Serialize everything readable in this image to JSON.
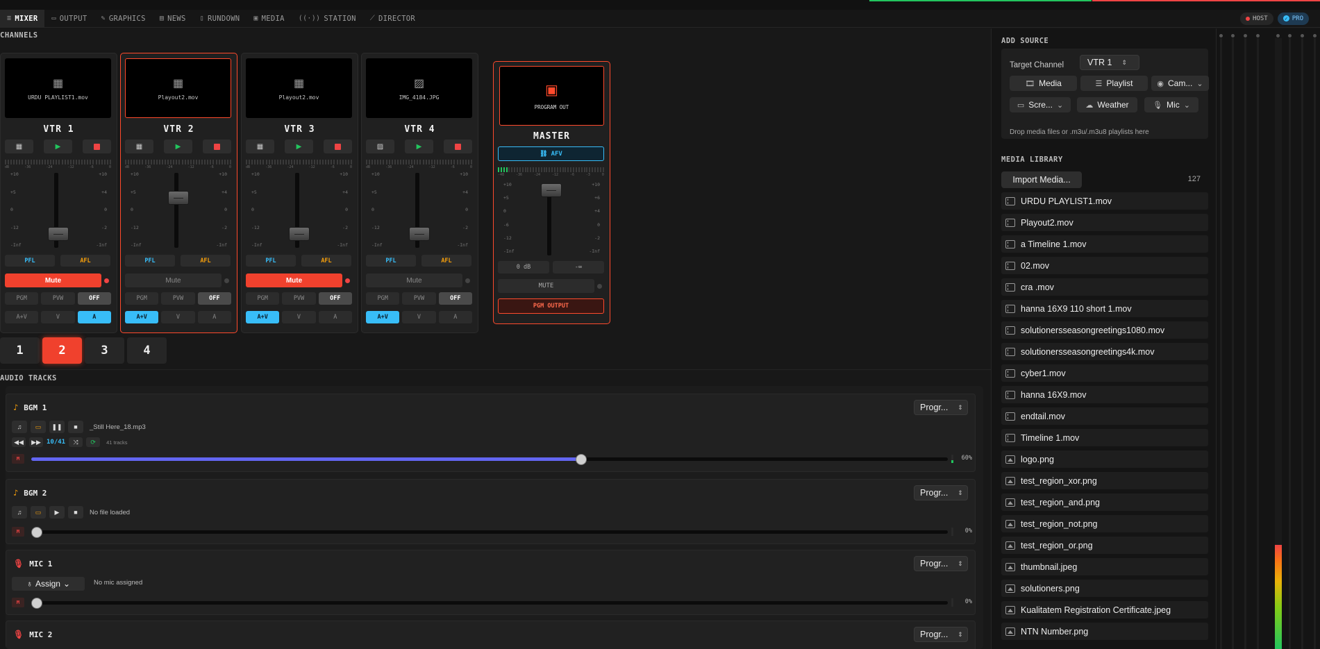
{
  "nav": {
    "items": [
      {
        "label": "MIXER",
        "icon": "sliders-icon",
        "active": true
      },
      {
        "label": "OUTPUT",
        "icon": "monitor-icon"
      },
      {
        "label": "GRAPHICS",
        "icon": "brush-icon"
      },
      {
        "label": "NEWS",
        "icon": "newspaper-icon"
      },
      {
        "label": "RUNDOWN",
        "icon": "doc-icon"
      },
      {
        "label": "MEDIA",
        "icon": "folder-icon"
      },
      {
        "label": "STATION",
        "icon": "antenna-icon"
      },
      {
        "label": "DIRECTOR",
        "icon": "wand-icon"
      }
    ],
    "host_label": "HOST",
    "pro_label": "PRO"
  },
  "channels": {
    "section_label": "CHANNELS",
    "strips": [
      {
        "name": "VTR 1",
        "file": "URDU PLAYLIST1.mov",
        "source_icon": "film-icon",
        "mute_label": "Mute",
        "muted": true,
        "route_active": "OFF",
        "mode_active": "A",
        "selected": false
      },
      {
        "name": "VTR 2",
        "file": "Playout2.mov",
        "source_icon": "film-icon",
        "mute_label": "Mute",
        "muted": false,
        "route_active": "OFF",
        "mode_active": "A+V",
        "selected": true
      },
      {
        "name": "VTR 3",
        "file": "Playout2.mov",
        "source_icon": "film-icon",
        "mute_label": "Mute",
        "muted": true,
        "route_active": "OFF",
        "mode_active": "A+V",
        "selected": false
      },
      {
        "name": "VTR 4",
        "file": "IMG_4184.JPG",
        "source_icon": "image-icon",
        "mute_label": "Mute",
        "muted": false,
        "route_active": "OFF",
        "mode_active": "A+V",
        "selected": false
      }
    ],
    "meter_scale": [
      "dB",
      "-36",
      "-24",
      "-12",
      "-6",
      "0"
    ],
    "fader_scale_left": [
      "+10",
      "+5",
      "0",
      "-12",
      "-Inf"
    ],
    "fader_scale_right": [
      "+10",
      "+4",
      "0",
      "-2",
      "-Inf"
    ],
    "pfl_label": "PFL",
    "afl_label": "AFL",
    "routes": [
      "PGM",
      "PVW",
      "OFF"
    ],
    "modes": [
      "A+V",
      "V",
      "A"
    ]
  },
  "master": {
    "preview_label": "PROGRAM OUT",
    "name": "MASTER",
    "afv_label": "AFV",
    "meter_scale": [
      "-48",
      "-36",
      "-24",
      "-12",
      "-6",
      "-3",
      "0"
    ],
    "fader_scale_left": [
      "+10",
      "+5",
      "0",
      "-6",
      "-12",
      "-Inf"
    ],
    "fader_scale_right": [
      "+10",
      "+6",
      "+4",
      "0",
      "-2",
      "-Inf"
    ],
    "level_db": "0 dB",
    "level_inf": "-∞",
    "mute_label": "MUTE",
    "output_label": "PGM OUTPUT"
  },
  "banks": {
    "items": [
      "1",
      "2",
      "3",
      "4"
    ],
    "active": "2"
  },
  "audio_tracks": {
    "section_label": "AUDIO TRACKS",
    "bgm1": {
      "name": "BGM 1",
      "file": "_Still Here_18.mp3",
      "counter": "10/41",
      "tracks_label": "41 tracks",
      "volume_pct": "60%",
      "volume": 0.6,
      "output": "Progr..."
    },
    "bgm2": {
      "name": "BGM 2",
      "file": "No file loaded",
      "volume_pct": "0%",
      "volume": 0,
      "output": "Progr..."
    },
    "mic1": {
      "name": "MIC 1",
      "assign_label": "Assign",
      "status": "No mic assigned",
      "volume_pct": "0%",
      "volume": 0,
      "output": "Progr..."
    },
    "mic2": {
      "name": "MIC 2",
      "output": "Progr..."
    },
    "mute_label": "M"
  },
  "add_source": {
    "section_label": "ADD SOURCE",
    "target_label": "Target Channel",
    "target_value": "VTR 1",
    "buttons": [
      {
        "label": "Media",
        "icon": "film-icon"
      },
      {
        "label": "Playlist",
        "icon": "list-icon"
      },
      {
        "label": "Cam...",
        "icon": "camera-icon"
      },
      {
        "label": "Scre...",
        "icon": "screen-icon"
      },
      {
        "label": "Weather",
        "icon": "weather-icon"
      },
      {
        "label": "Mic",
        "icon": "mic-icon"
      }
    ],
    "drop_hint": "Drop media files or .m3u/.m3u8 playlists here"
  },
  "media_library": {
    "section_label": "MEDIA LIBRARY",
    "import_label": "Import Media...",
    "count": "127",
    "items": [
      {
        "name": "URDU PLAYLIST1.mov",
        "type": "video"
      },
      {
        "name": "Playout2.mov",
        "type": "video"
      },
      {
        "name": "a Timeline 1.mov",
        "type": "video"
      },
      {
        "name": "02.mov",
        "type": "video"
      },
      {
        "name": "cra .mov",
        "type": "video"
      },
      {
        "name": "hanna 16X9 110 short 1.mov",
        "type": "video"
      },
      {
        "name": "solutionersseasongreetings1080.mov",
        "type": "video"
      },
      {
        "name": "solutionersseasongreetings4k.mov",
        "type": "video"
      },
      {
        "name": "cyber1.mov",
        "type": "video"
      },
      {
        "name": "hanna 16X9.mov",
        "type": "video"
      },
      {
        "name": "endtail.mov",
        "type": "video"
      },
      {
        "name": "Timeline 1.mov",
        "type": "video"
      },
      {
        "name": "logo.png",
        "type": "image"
      },
      {
        "name": "test_region_xor.png",
        "type": "image"
      },
      {
        "name": "test_region_and.png",
        "type": "image"
      },
      {
        "name": "test_region_not.png",
        "type": "image"
      },
      {
        "name": "test_region_or.png",
        "type": "image"
      },
      {
        "name": "thumbnail.jpeg",
        "type": "image"
      },
      {
        "name": "solutioners.png",
        "type": "image"
      },
      {
        "name": "Kualitatem Registration Certificate.jpeg",
        "type": "image"
      },
      {
        "name": "NTN Number.png",
        "type": "image"
      }
    ]
  },
  "colors": {
    "accent": "#ff4a2c",
    "cyan": "#38bdf8",
    "amber": "#f59e0b",
    "green": "#22c55e",
    "indigo": "#6366f1"
  }
}
